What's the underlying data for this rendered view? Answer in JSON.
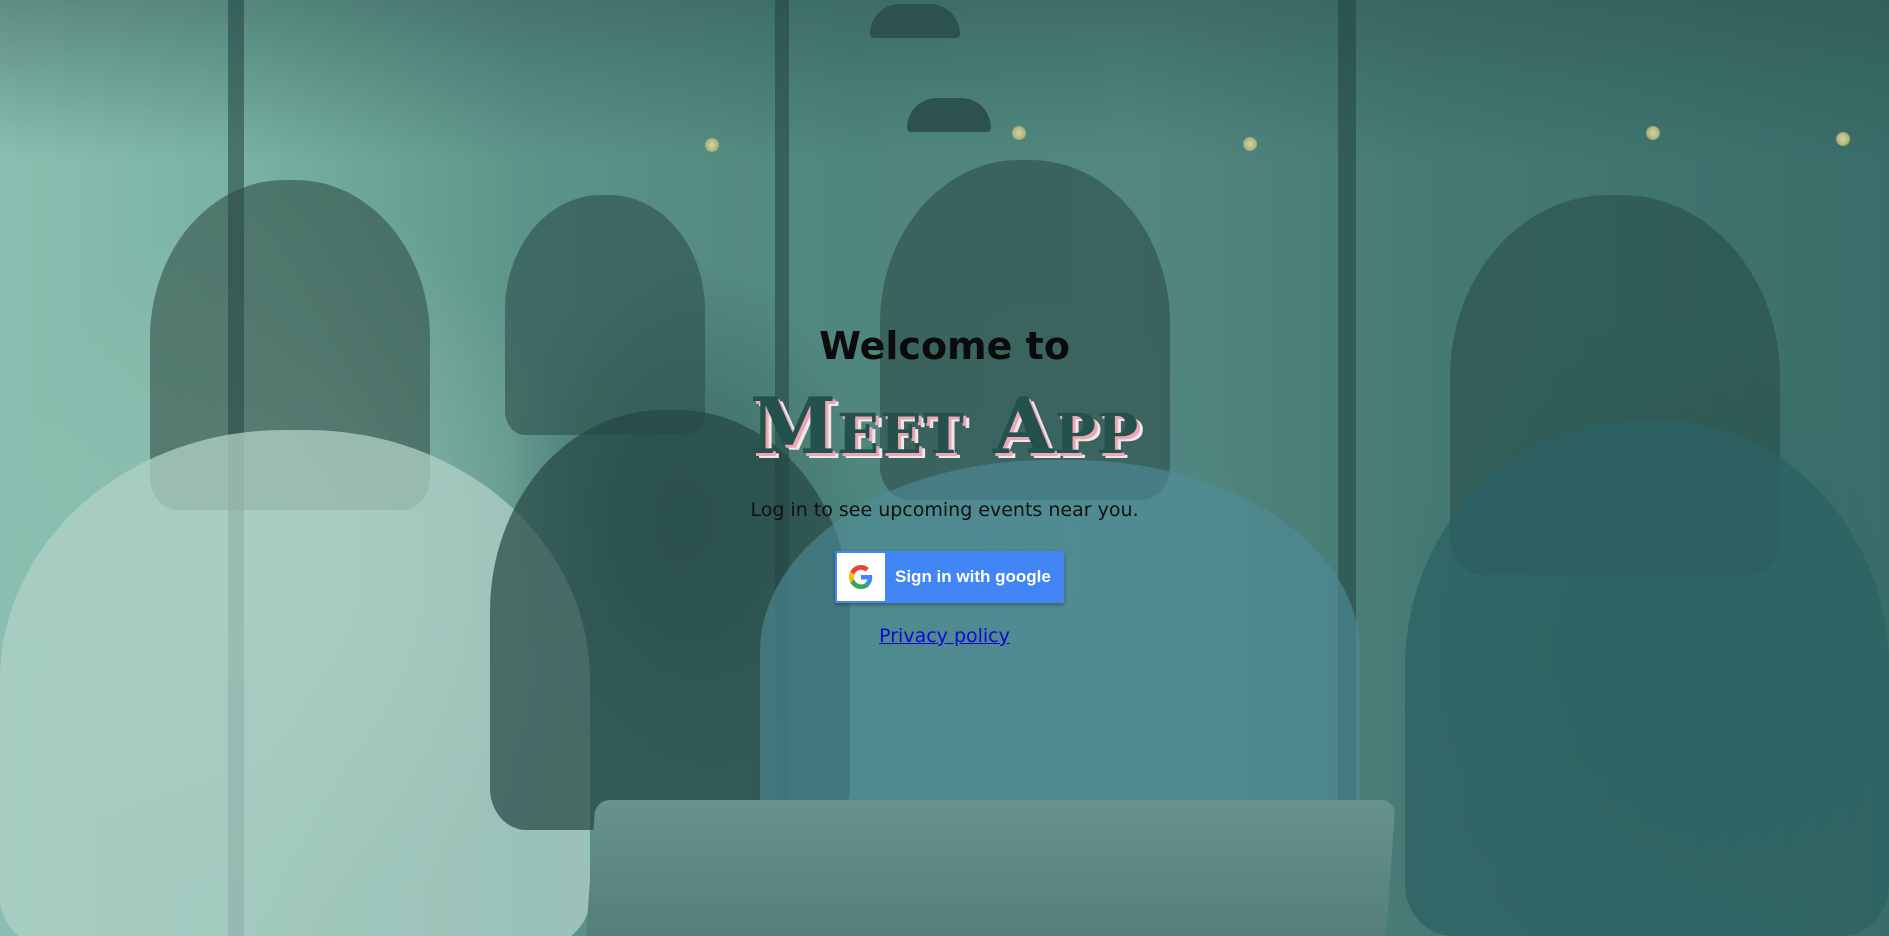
{
  "login": {
    "welcome": "Welcome to",
    "app_title": "Meet App",
    "subtitle": "Log in to see upcoming events near you.",
    "google_button_label": "Sign in with google",
    "privacy_link": "Privacy policy"
  },
  "background": {
    "image_subject": "team-meeting-photo",
    "overlay_color": "#2f8a72"
  },
  "colors": {
    "google_blue": "#4285f4",
    "title_color": "#24514b",
    "title_shadow": "#e8a8b6",
    "link_color": "#0b0bd6"
  },
  "icons": {
    "google_logo": "google-g-icon"
  }
}
